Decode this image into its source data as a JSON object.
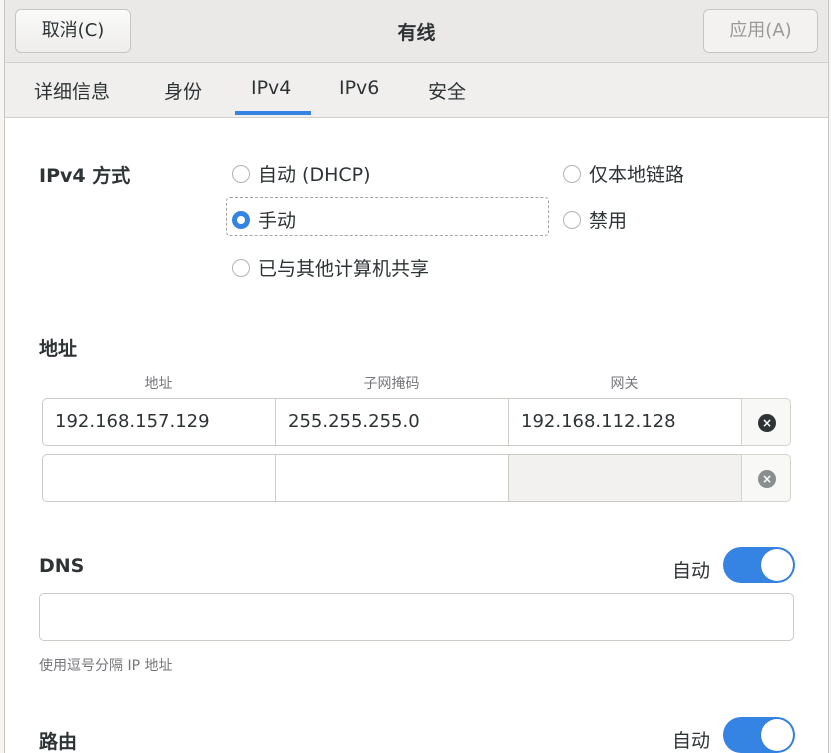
{
  "header": {
    "cancel_label": "取消(C)",
    "title": "有线",
    "apply_label": "应用(A)"
  },
  "tabs": [
    {
      "label": "详细信息"
    },
    {
      "label": "身份"
    },
    {
      "label": "IPv4",
      "active": true
    },
    {
      "label": "IPv6"
    },
    {
      "label": "安全"
    }
  ],
  "ipv4_method": {
    "label": "IPv4 方式",
    "options": [
      {
        "label": "自动 (DHCP)",
        "checked": false
      },
      {
        "label": "仅本地链路",
        "checked": false
      },
      {
        "label": "手动",
        "checked": true
      },
      {
        "label": "禁用",
        "checked": false
      },
      {
        "label": "已与其他计算机共享",
        "checked": false
      }
    ]
  },
  "address": {
    "section_label": "地址",
    "columns": [
      "地址",
      "子网掩码",
      "网关"
    ],
    "rows": [
      {
        "address": "192.168.157.129",
        "netmask": "255.255.255.0",
        "gateway": "192.168.112.128"
      },
      {
        "address": "",
        "netmask": "",
        "gateway": ""
      }
    ],
    "delete_icon": "circle-x-icon"
  },
  "dns": {
    "label": "DNS",
    "auto_label": "自动",
    "auto_on": true,
    "value": "",
    "hint": "使用逗号分隔 IP 地址"
  },
  "routes": {
    "label": "路由",
    "auto_label": "自动",
    "auto_on": true
  },
  "colors": {
    "accent": "#3584e4",
    "header_bg": "#ebe9e7"
  }
}
